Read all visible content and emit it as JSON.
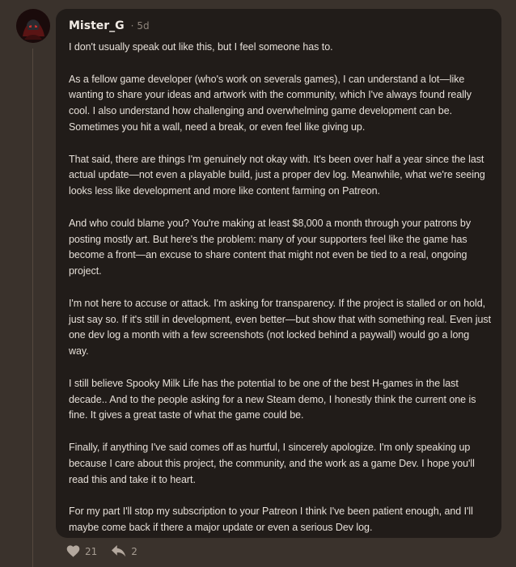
{
  "comment": {
    "username": "Mister_G",
    "time_separator": "·",
    "time": "5d",
    "paragraphs": [
      "I don't usually speak out like this, but I feel someone has to.",
      "As a fellow game developer (who's work on severals games), I can understand a lot—like wanting to share your ideas and artwork with the community, which I've always found really cool. I also understand how challenging and overwhelming game development can be. Sometimes you hit a wall, need a break, or even feel like giving up.",
      "That said, there are things I'm genuinely not okay with. It's been over half a year since the last actual update—not even a playable build, just a proper dev log. Meanwhile, what we're seeing looks less like development and more like content farming on Patreon.",
      "And who could blame you? You're making at least $8,000 a month through your patrons by posting mostly art. But here's the problem: many of your supporters feel like the game has become a front—an excuse to share content that might not even be tied to a real, ongoing project.",
      "I'm not here to accuse or attack. I'm asking for transparency. If the project is stalled or on hold, just say so. If it's still in development, even better—but show that with something real. Even just one dev log a month with a few screenshots (not locked behind a paywall) would go a long way.",
      "I still believe Spooky Milk Life has the potential to be one of the best H-games in the last decade.. And to the people asking for a new Steam demo, I honestly think the current one is fine. It gives a great taste of what the game could be.",
      "Finally, if anything I've said comes off as hurtful, I sincerely apologize. I'm only speaking up because I care about this project, the community, and the work as a game Dev. I hope you'll read this and take it to heart.",
      "For my part I'll stop my subscription to your Patreon I think I've been patient enough, and I'll maybe come back if there a major update or even a serious Dev log."
    ]
  },
  "actions": {
    "like_icon": "heart-icon",
    "like_count": "21",
    "reply_icon": "reply-arrow-icon",
    "reply_count": "2"
  },
  "colors": {
    "page_background": "#3a322c",
    "bubble_background": "#211c19",
    "text": "#e6dfd8",
    "muted": "#a69c92"
  }
}
